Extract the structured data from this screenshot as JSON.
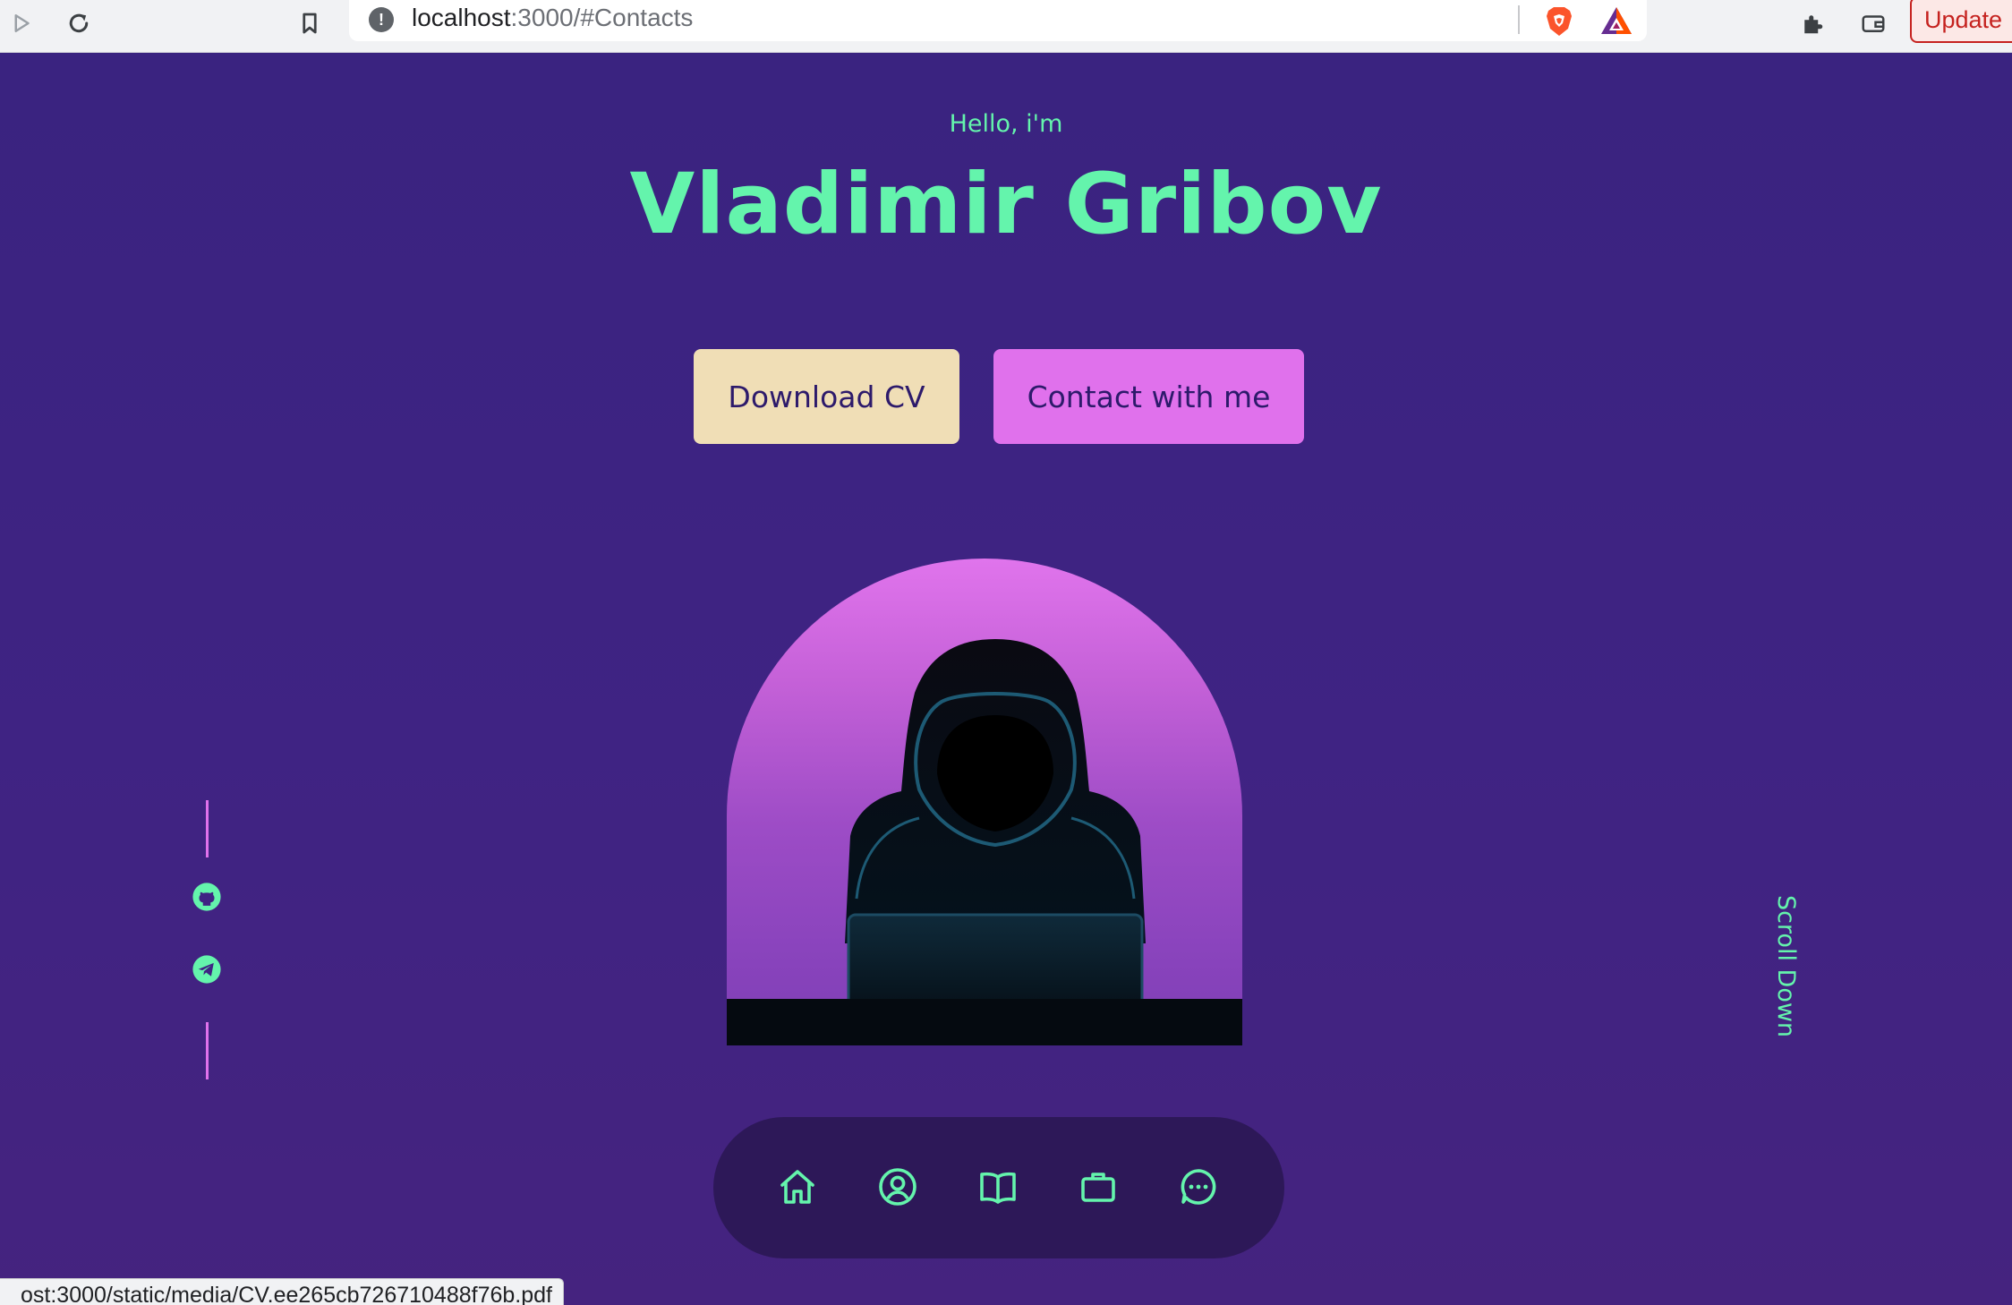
{
  "browser": {
    "url_host": "localhost",
    "url_rest": ":3000/#Contacts",
    "update_label": "Update"
  },
  "hero": {
    "greeting": "Hello, i'm",
    "name": "Vladimir Gribov",
    "download_cv_label": "Download CV",
    "contact_label": "Contact with me"
  },
  "social": {
    "links": [
      "github-icon",
      "telegram-icon"
    ]
  },
  "scroll_label": "Scroll Down",
  "nav": {
    "items": [
      "home-icon",
      "user-icon",
      "book-icon",
      "briefcase-icon",
      "chat-icon"
    ]
  },
  "status_bar": {
    "link": "ost:3000/static/media/CV.ee265cb726710488f76b.pdf"
  },
  "colors": {
    "background": "#3a2380",
    "accent_green": "#64f4ac",
    "accent_pink": "#e071ec",
    "cv_button": "#f0deb6",
    "nav_background": "#2d1858"
  }
}
